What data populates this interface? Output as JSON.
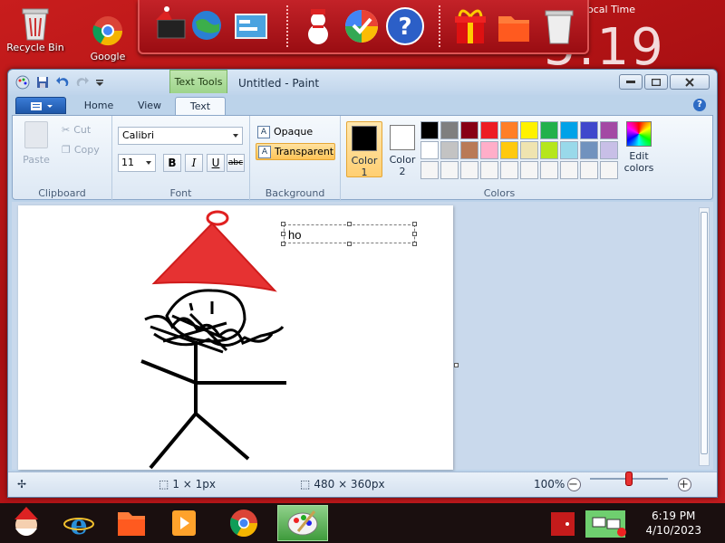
{
  "desktop": {
    "icons": [
      {
        "label": "Recycle Bin"
      },
      {
        "label": "Google"
      }
    ],
    "clock_widget": {
      "label": "ocal Time",
      "time": "5:19"
    }
  },
  "window": {
    "title": "Untitled - Paint",
    "context_tab_group": "Text Tools",
    "tabs": [
      {
        "label": "Home"
      },
      {
        "label": "View"
      },
      {
        "label": "Text"
      }
    ]
  },
  "ribbon": {
    "clipboard": {
      "paste": "Paste",
      "cut": "Cut",
      "copy": "Copy",
      "label": "Clipboard"
    },
    "font": {
      "family": "Calibri",
      "size": "11",
      "bold": "B",
      "italic": "I",
      "underline": "U",
      "strike": "abc",
      "label": "Font"
    },
    "background": {
      "opaque": "Opaque",
      "transparent": "Transparent",
      "label": "Background",
      "selected": "Transparent"
    },
    "colors": {
      "color1_label": "Color\n1",
      "color1_line1": "Color",
      "color1_line2": "1",
      "color2_line1": "Color",
      "color2_line2": "2",
      "color1_value": "#000000",
      "color2_value": "#ffffff",
      "edit_line1": "Edit",
      "edit_line2": "colors",
      "label": "Colors",
      "palette": [
        "#000000",
        "#7f7f7f",
        "#880015",
        "#ed1c24",
        "#ff7f27",
        "#fff200",
        "#22b14c",
        "#00a2e8",
        "#3f48cc",
        "#a349a4",
        "#ffffff",
        "#c3c3c3",
        "#b97a57",
        "#ffaec9",
        "#ffc90e",
        "#efe4b0",
        "#b5e61d",
        "#99d9ea",
        "#7092be",
        "#c8bfe7",
        "#f5f5f5",
        "#f5f5f5",
        "#f5f5f5",
        "#f5f5f5",
        "#f5f5f5",
        "#f5f5f5",
        "#f5f5f5",
        "#f5f5f5",
        "#f5f5f5",
        "#f5f5f5"
      ]
    }
  },
  "canvas": {
    "text_entry": "ho"
  },
  "status": {
    "selection_size": "1 × 1px",
    "image_size": "480 × 360px",
    "zoom": "100%",
    "zoom_level": 0.5
  },
  "taskbar": {
    "time": "6:19 PM",
    "date": "4/10/2023"
  }
}
